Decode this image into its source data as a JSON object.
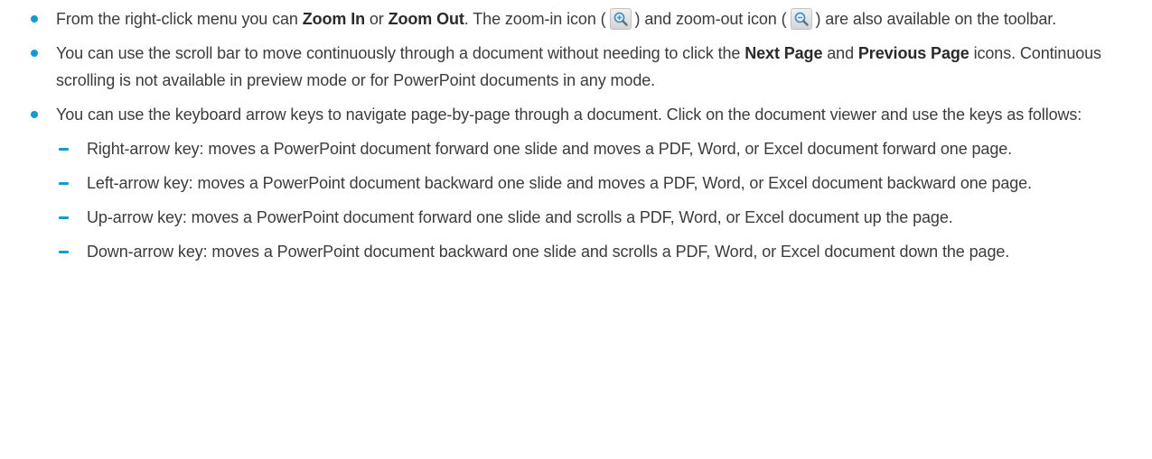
{
  "colors": {
    "accent": "#1598d6",
    "text": "#3c3c3c",
    "icon_lens": "#4a90c8"
  },
  "bullets": [
    {
      "segments": [
        {
          "text": "From the right-click menu you can "
        },
        {
          "text": "Zoom In",
          "bold": true
        },
        {
          "text": " or "
        },
        {
          "text": "Zoom Out",
          "bold": true
        },
        {
          "text": ". The zoom-in icon ("
        },
        {
          "icon": "zoom-in-icon"
        },
        {
          "text": ") and zoom-out icon ("
        },
        {
          "icon": "zoom-out-icon"
        },
        {
          "text": ") are also available on the toolbar."
        }
      ]
    },
    {
      "segments": [
        {
          "text": "You can use the scroll bar to move continuously through a document without needing to click the "
        },
        {
          "text": "Next Page",
          "bold": true
        },
        {
          "text": " and "
        },
        {
          "text": "Previous Page",
          "bold": true
        },
        {
          "text": " icons. Continuous scrolling is not available in preview mode or for PowerPoint documents in any mode."
        }
      ]
    },
    {
      "segments": [
        {
          "text": "You can use the keyboard arrow keys to navigate page-by-page through a document. Click on the document viewer and use the keys as follows:"
        }
      ],
      "sub_items": [
        "Right-arrow key: moves a PowerPoint document forward one slide and moves a PDF, Word, or Excel document forward one page.",
        "Left-arrow key: moves a PowerPoint document backward one slide and moves a PDF, Word, or Excel document backward one page.",
        "Up-arrow key: moves a PowerPoint document forward one slide and scrolls a PDF, Word, or Excel document up the page.",
        "Down-arrow key: moves a PowerPoint document backward one slide and scrolls a PDF, Word, or Excel document down the page."
      ]
    }
  ]
}
